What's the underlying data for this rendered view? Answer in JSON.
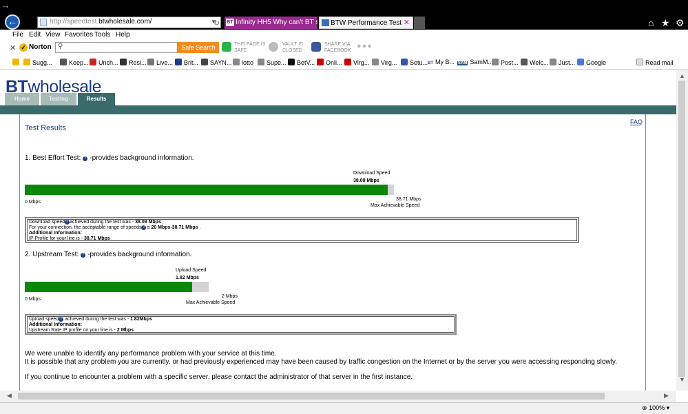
{
  "browser": {
    "url_prefix": "http://speedtest.",
    "url_domain": "btwholesale.com/",
    "tabs": [
      {
        "title": "Infinity HH5 Why can't BT sort ..."
      },
      {
        "title": "BTW Performance Test"
      }
    ],
    "tab1_favicon": "BT"
  },
  "menu": [
    "File",
    "Edit",
    "View",
    "Favorites",
    "Tools",
    "Help"
  ],
  "norton": {
    "logo": "Norton",
    "search_button": "Safe Search",
    "page_safe_1": "THIS PAGE IS",
    "page_safe_2": "SAFE",
    "vault_1": "VAULT IS",
    "vault_2": "CLOSED",
    "share_1": "SHARE VIA",
    "share_2": "FACEBOOK"
  },
  "favorites": [
    {
      "label": "Sugg...",
      "color": "#f2b800"
    },
    {
      "label": "Keep...",
      "color": "#555555"
    },
    {
      "label": "Unch...",
      "color": "#cc2222"
    },
    {
      "label": "Resi...",
      "color": "#333333"
    },
    {
      "label": "Live...",
      "color": "#777777"
    },
    {
      "label": "Brit...",
      "color": "#1f3d84"
    },
    {
      "label": "SAYN...",
      "color": "#444444"
    },
    {
      "label": "lotto",
      "color": "#888888"
    },
    {
      "label": "Supe...",
      "color": "#888888"
    },
    {
      "label": "BetV...",
      "color": "#111111"
    },
    {
      "label": "Onli...",
      "color": "#cc0000"
    },
    {
      "label": "Virg...",
      "color": "#cc0000"
    },
    {
      "label": "Virg...",
      "color": "#888888"
    },
    {
      "label": "Setu...",
      "color": "#3355aa"
    },
    {
      "label": "My B...",
      "color": "#1f3d84"
    },
    {
      "label": "SamM...",
      "color": "#225588"
    },
    {
      "label": "Post...",
      "color": "#888888"
    },
    {
      "label": "Welc...",
      "color": "#555555"
    },
    {
      "label": "Just...",
      "color": "#888888"
    },
    {
      "label": "Google",
      "color": "#4477dd"
    }
  ],
  "favorites_bt_badge": "BT",
  "favorites_sam_badge": "SAM",
  "read_mail": "Read mail",
  "site": {
    "logo_bt": "BT",
    "logo_rest": "wholesale",
    "nav": [
      "Home",
      "Testing",
      "Results"
    ],
    "faq": "FAQ",
    "title": "Test Results"
  },
  "best_effort": {
    "title": "1. Best Effort Test:",
    "desc": "-provides background information.",
    "speed_label": "Download Speed",
    "speed_value": "38.09 Mbps",
    "min_label": "0 Mbps",
    "max_value": "38.71 Mbps",
    "max_label": "Max Achievable Speed",
    "line1_a": "Download speed",
    "line1_b": "achieved during the test was - ",
    "line1_c": "38.09 Mbps",
    "line2_a": "For your connection, the acceptable range of speeds",
    "line2_b": "is ",
    "line2_c": "20 Mbps-38.71 Mbps",
    "line2_d": " .",
    "line3": "Additional Information:",
    "line4_a": "IP Profile for your line is - ",
    "line4_b": "38.71 Mbps"
  },
  "upstream": {
    "title": "2. Upstream Test:",
    "desc": "-provides background information.",
    "speed_label": "Upload Speed",
    "speed_value": "1.82 Mbps",
    "min_label": "0 Mbps",
    "max_value": "2 Mbps",
    "max_label": "Max Achievable Speed",
    "line1_a": "Upload speed",
    "line1_b": " achieved during the test was - ",
    "line1_c": "1.82Mbps",
    "line2": "Additional Information:",
    "line3_a": "Upstream Rate IP profile on your line is - ",
    "line3_b": "2 Mbps"
  },
  "bars": {
    "download_fraction": 0.984,
    "upload_fraction": 0.91
  },
  "message": {
    "p1": "We were unable to identify any performance problem with your service at this time.",
    "p2": "It is possible that any problem you are currently, or had previously experienced may have been caused by traffic congestion on the Internet or by the server you were accessing responding slowly.",
    "p3": "If you continue to encounter a problem with a specific server, please contact the administrator of that server in the first instance."
  },
  "status": {
    "zoom": "100%"
  }
}
